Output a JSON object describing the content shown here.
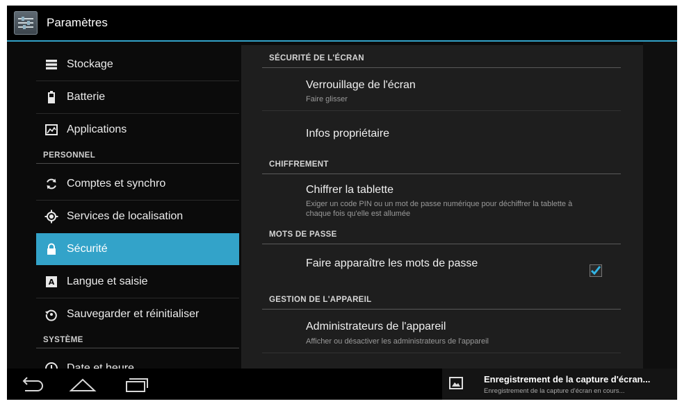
{
  "action_bar": {
    "title": "Paramètres"
  },
  "left_nav": {
    "items_top": [
      {
        "label": "Stockage"
      },
      {
        "label": "Batterie"
      },
      {
        "label": "Applications"
      }
    ],
    "section_personal": "PERSONNEL",
    "items_personal": [
      {
        "label": "Comptes et synchro"
      },
      {
        "label": "Services de localisation"
      },
      {
        "label": "Sécurité",
        "active": true
      },
      {
        "label": "Langue et saisie"
      },
      {
        "label": "Sauvegarder et réinitialiser"
      }
    ],
    "section_system": "SYSTÈME",
    "items_system": [
      {
        "label": "Date et heure"
      }
    ]
  },
  "detail": {
    "sections": [
      {
        "header": "SÉCURITÉ DE L'ÉCRAN",
        "items": [
          {
            "title": "Verrouillage de l'écran",
            "summary": "Faire glisser"
          },
          {
            "title": "Infos propriétaire"
          }
        ]
      },
      {
        "header": "CHIFFREMENT",
        "items": [
          {
            "title": "Chiffrer la tablette",
            "summary": "Exiger un code PIN ou un mot de passe numérique pour déchiffrer la tablette à chaque fois qu'elle est allumée"
          }
        ]
      },
      {
        "header": "MOTS DE PASSE",
        "items": [
          {
            "title": "Faire apparaître les mots de passe",
            "checked": true
          }
        ]
      },
      {
        "header": "GESTION DE L'APPAREIL",
        "items": [
          {
            "title": "Administrateurs de l'appareil",
            "summary": "Afficher ou désactiver les administrateurs de l'appareil"
          }
        ]
      }
    ]
  },
  "notification": {
    "title": "Enregistrement de la capture d'écran...",
    "text": "Enregistrement de la capture d'écran en cours..."
  },
  "colors": {
    "accent": "#33a3c9",
    "background": "#0b0b0b",
    "panel": "#1e1e1e"
  }
}
